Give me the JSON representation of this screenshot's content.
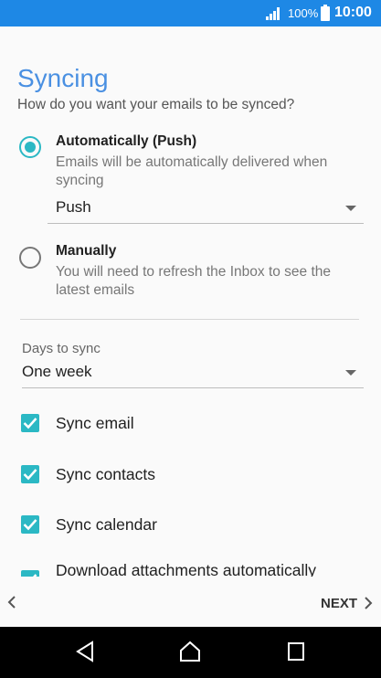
{
  "status_bar": {
    "battery_percent": "100%",
    "time": "10:00",
    "icons": [
      "signal-icon",
      "battery-icon"
    ]
  },
  "screen": {
    "title": "Syncing",
    "subtitle": "How do you want your emails to be synced?"
  },
  "sync_options": [
    {
      "title": "Automatically (Push)",
      "description": "Emails will be automatically delivered when syncing",
      "selected": true
    },
    {
      "title": "Manually",
      "description": "You will need to refresh the Inbox to see the latest emails",
      "selected": false
    }
  ],
  "push_dropdown": {
    "value": "Push"
  },
  "days_to_sync": {
    "label": "Days to sync",
    "value": "One week"
  },
  "checkboxes": [
    {
      "label": "Sync email",
      "checked": true
    },
    {
      "label": "Sync contacts",
      "checked": true
    },
    {
      "label": "Sync calendar",
      "checked": true
    },
    {
      "label": "Download attachments automatically",
      "checked": true
    }
  ],
  "navigation": {
    "next_label": "NEXT"
  },
  "colors": {
    "status_bar": "#1e88e5",
    "accent": "#2bb8c4",
    "title": "#4a90e2"
  }
}
